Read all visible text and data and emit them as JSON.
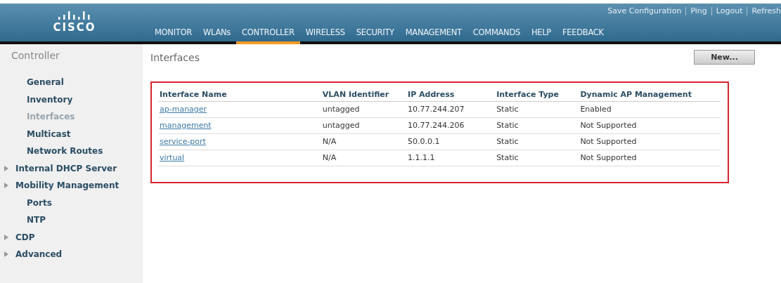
{
  "header": {
    "logo_text": "CISCO",
    "top_links": [
      "Save Configuration",
      "Ping",
      "Logout",
      "Refresh"
    ],
    "nav": [
      {
        "label": "MONITOR",
        "selected": false
      },
      {
        "label": "WLANs",
        "selected": false
      },
      {
        "label": "CONTROLLER",
        "selected": true
      },
      {
        "label": "WIRELESS",
        "selected": false
      },
      {
        "label": "SECURITY",
        "selected": false
      },
      {
        "label": "MANAGEMENT",
        "selected": false
      },
      {
        "label": "COMMANDS",
        "selected": false
      },
      {
        "label": "HELP",
        "selected": false
      },
      {
        "label": "FEEDBACK",
        "selected": false
      }
    ]
  },
  "sidebar": {
    "title": "Controller",
    "items": [
      {
        "label": "General",
        "selected": false,
        "expandable": false
      },
      {
        "label": "Inventory",
        "selected": false,
        "expandable": false
      },
      {
        "label": "Interfaces",
        "selected": true,
        "expandable": false
      },
      {
        "label": "Multicast",
        "selected": false,
        "expandable": false
      },
      {
        "label": "Network Routes",
        "selected": false,
        "expandable": false
      },
      {
        "label": "Internal DHCP Server",
        "selected": false,
        "expandable": true
      },
      {
        "label": "Mobility Management",
        "selected": false,
        "expandable": true
      },
      {
        "label": "Ports",
        "selected": false,
        "expandable": false
      },
      {
        "label": "NTP",
        "selected": false,
        "expandable": false
      },
      {
        "label": "CDP",
        "selected": false,
        "expandable": true
      },
      {
        "label": "Advanced",
        "selected": false,
        "expandable": true
      }
    ]
  },
  "page": {
    "title": "Interfaces",
    "new_button": "New...",
    "table": {
      "columns": [
        "Interface Name",
        "VLAN Identifier",
        "IP Address",
        "Interface Type",
        "Dynamic AP Management"
      ],
      "rows": [
        [
          "ap-manager",
          "untagged",
          "10.77.244.207",
          "Static",
          "Enabled"
        ],
        [
          "management",
          "untagged",
          "10.77.244.206",
          "Static",
          "Not Supported"
        ],
        [
          "service-port",
          "N/A",
          "50.0.0.1",
          "Static",
          "Not Supported"
        ],
        [
          "virtual",
          "N/A",
          "1.1.1.1",
          "Static",
          "Not Supported"
        ]
      ]
    }
  }
}
